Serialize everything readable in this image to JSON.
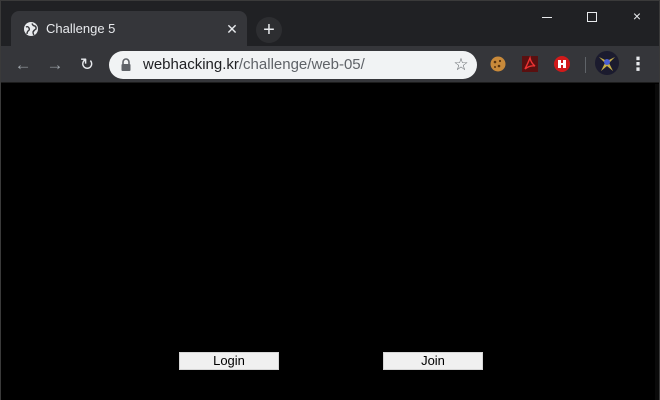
{
  "window": {
    "controls": {
      "minimize": "minimize",
      "maximize": "maximize",
      "close": "×"
    }
  },
  "tab": {
    "title": "Challenge 5",
    "favicon": "globe-icon",
    "close_glyph": "✕"
  },
  "new_tab_glyph": "+",
  "toolbar": {
    "back_glyph": "←",
    "forward_glyph": "→",
    "reload_glyph": "↻",
    "url_host": "webhacking.kr",
    "url_path": "/challenge/web-05/",
    "star_glyph": "☆",
    "extensions": [
      "cookie-extension-icon",
      "pdf-extension-icon",
      "hacking-extension-icon"
    ],
    "menu_glyph": "⋮"
  },
  "page": {
    "background": "#000000",
    "buttons": {
      "login": "Login",
      "join": "Join"
    }
  }
}
